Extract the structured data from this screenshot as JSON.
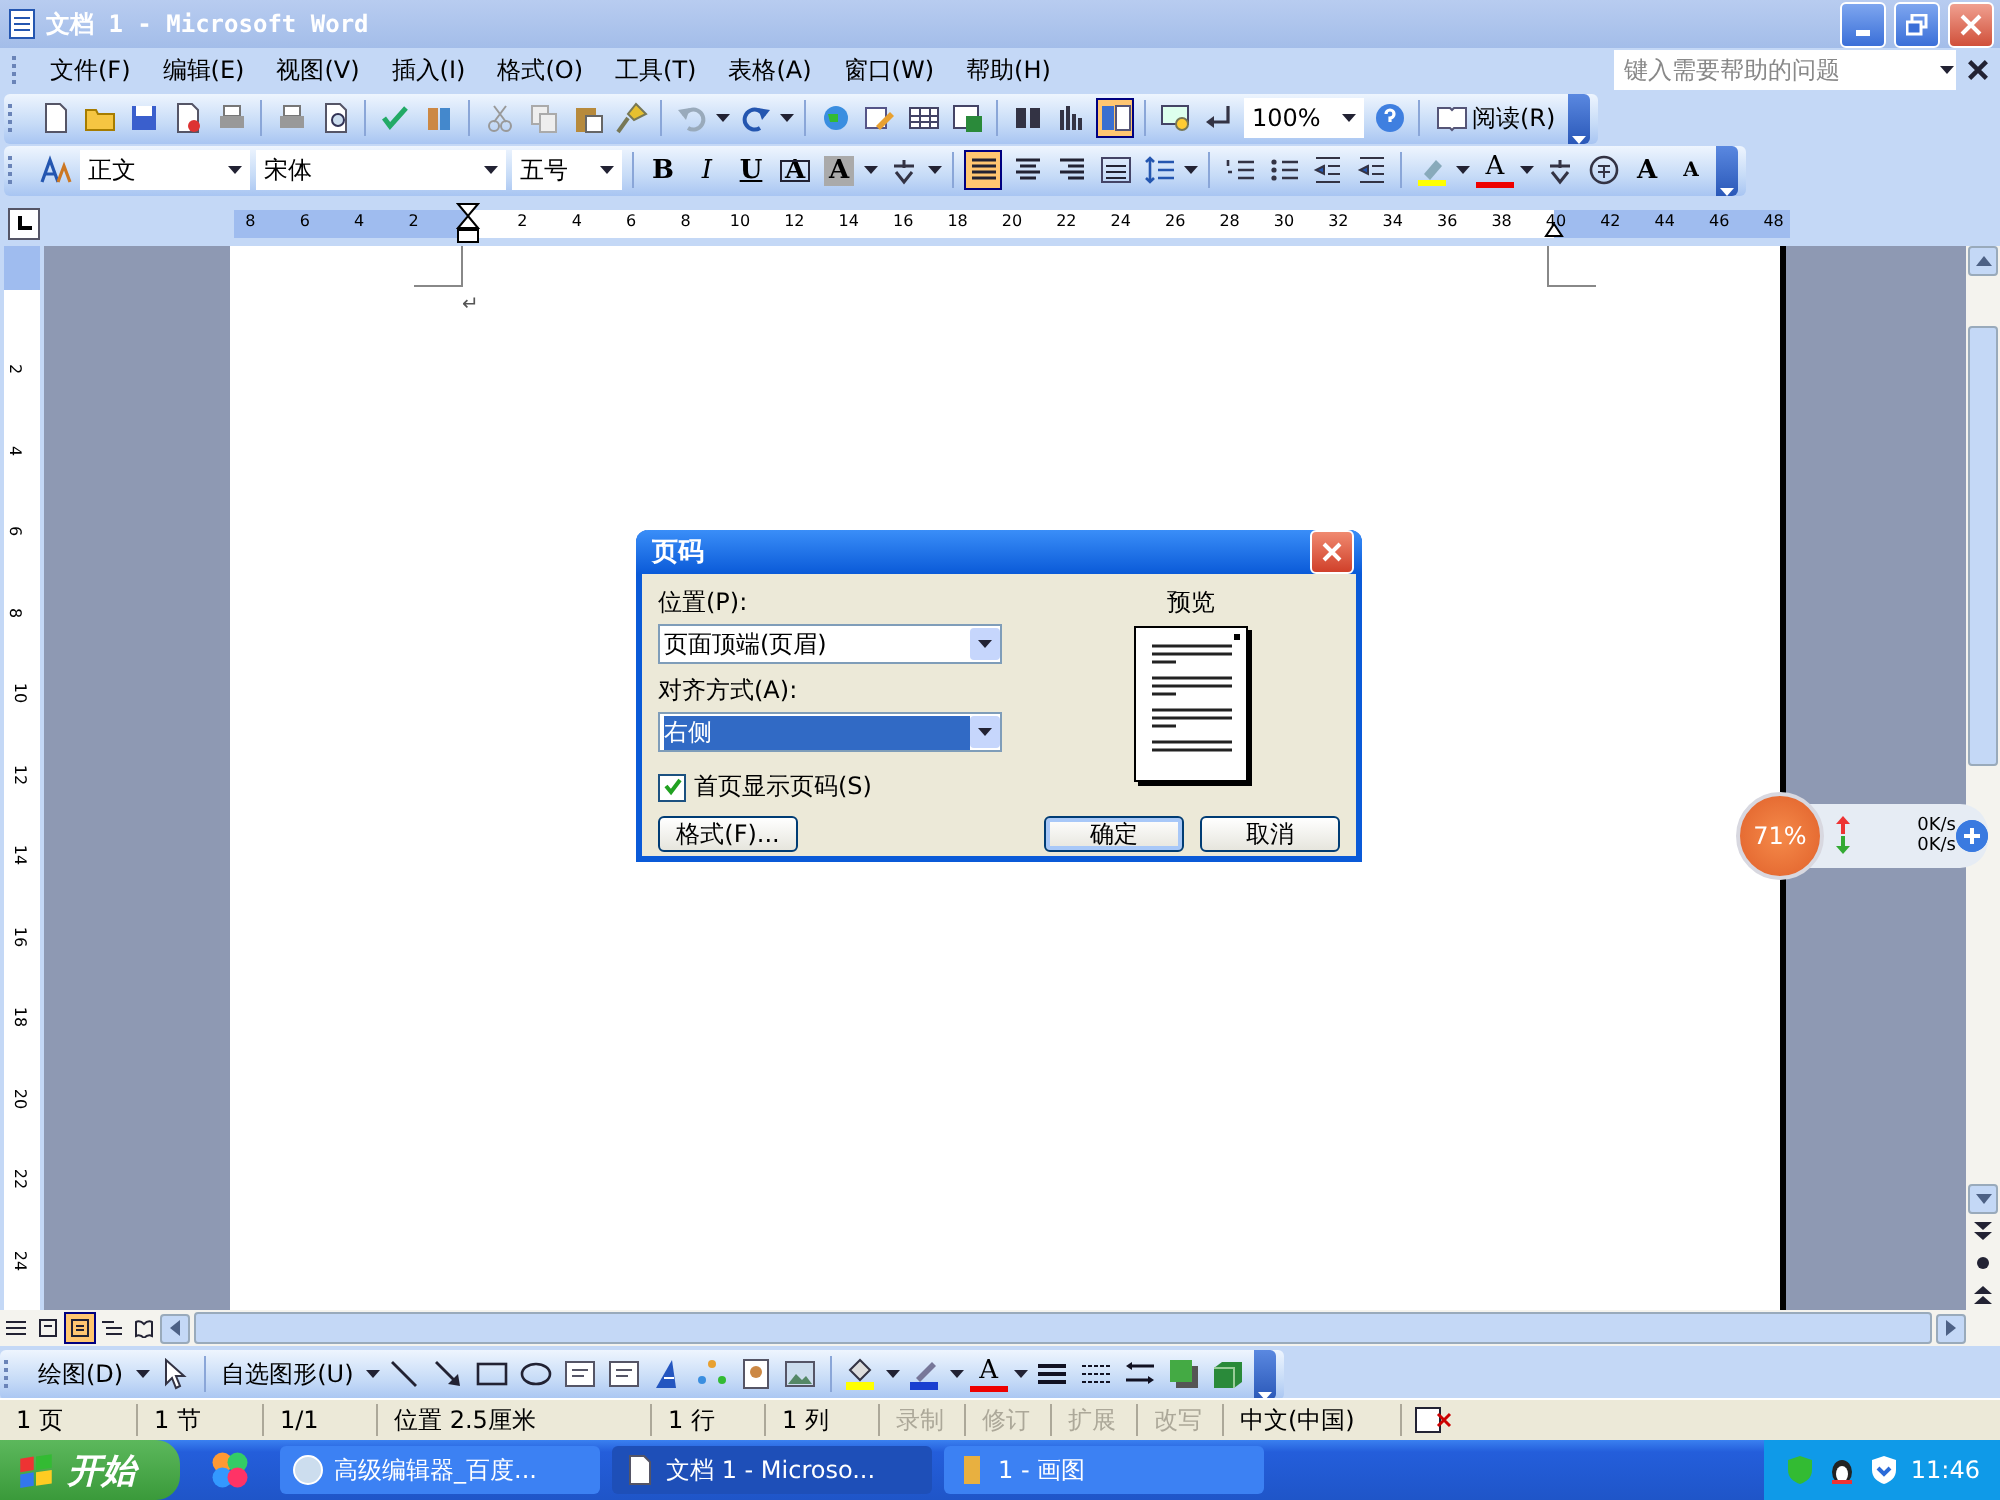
{
  "window": {
    "title": "文档 1 - Microsoft Word"
  },
  "menu_bar": {
    "items": [
      "文件(F)",
      "编辑(E)",
      "视图(V)",
      "插入(I)",
      "格式(O)",
      "工具(T)",
      "表格(A)",
      "窗口(W)",
      "帮助(H)"
    ],
    "help_search": {
      "placeholder": "键入需要帮助的问题"
    }
  },
  "standard_toolbar": {
    "document_map_on": true,
    "zoom": "100%",
    "read_button": "阅读(R)"
  },
  "formatting_toolbar": {
    "style": "正文",
    "font": "宋体",
    "size": "五号",
    "format_buttons": [
      {
        "kind": "bold",
        "label": "B"
      },
      {
        "kind": "italic",
        "label": "I"
      },
      {
        "kind": "underline",
        "label": "U"
      },
      {
        "kind": "border",
        "label": "A"
      },
      {
        "kind": "shade",
        "label": "A"
      }
    ],
    "alignment_buttons": [
      {
        "selected": true
      },
      {
        "selected": false
      },
      {
        "selected": false
      },
      {
        "selected": false
      }
    ],
    "font_color_label": "A",
    "grow_font_label": "A",
    "shrink_font_label": "A"
  },
  "ruler": {
    "left_labels": [
      "8",
      "6",
      "4",
      "2"
    ],
    "right_labels": [
      "2",
      "4",
      "6",
      "8",
      "10",
      "12",
      "14",
      "16",
      "18",
      "20",
      "22",
      "24",
      "26",
      "28",
      "30",
      "32",
      "34",
      "36",
      "38",
      "40",
      "42",
      "44",
      "46",
      "48"
    ]
  },
  "vertical_ruler": {
    "labels": [
      "2",
      "4",
      "6",
      "8",
      "10",
      "12",
      "14",
      "16",
      "18",
      "20",
      "22",
      "24"
    ]
  },
  "document": {
    "paragraph_mark": "↵"
  },
  "dialog": {
    "title": "页码",
    "position_label": "位置(P):",
    "position_value": "页面顶端(页眉)",
    "alignment_label": "对齐方式(A):",
    "alignment_value": "右侧",
    "first_page_checkbox": {
      "label": "首页显示页码(S)",
      "checked": true
    },
    "preview_label": "预览",
    "buttons": [
      {
        "kind": "format",
        "label": "格式(F)..."
      },
      {
        "kind": "ok",
        "label": "确定"
      },
      {
        "kind": "cancel",
        "label": "取消"
      }
    ]
  },
  "speed_widget": {
    "percent": "71%",
    "upload": "0K/s",
    "download": "0K/s"
  },
  "view_buttons": [
    {
      "selected": false
    },
    {
      "selected": false
    },
    {
      "selected": true
    },
    {
      "selected": false
    },
    {
      "selected": false
    }
  ],
  "drawing_toolbar": {
    "draw_menu": "绘图(D)",
    "autoshapes_menu": "自选图形(U)",
    "font_color_label": "A"
  },
  "status_bar": {
    "items": [
      {
        "text": "1 页",
        "disabled": false
      },
      {
        "text": "1 节",
        "disabled": false
      },
      {
        "text": "1/1",
        "disabled": false
      },
      {
        "text": "位置 2.5厘米",
        "disabled": false
      },
      {
        "text": "1 行",
        "disabled": false
      },
      {
        "text": "1 列",
        "disabled": false
      },
      {
        "text": "录制",
        "disabled": true
      },
      {
        "text": "修订",
        "disabled": true
      },
      {
        "text": "扩展",
        "disabled": true
      },
      {
        "text": "改写",
        "disabled": true
      },
      {
        "text": "中文(中国)",
        "disabled": false
      }
    ]
  },
  "taskbar": {
    "start": "开始",
    "tasks": [
      {
        "label": "高级编辑器_百度...",
        "selected": false
      },
      {
        "label": "文档 1 - Microso...",
        "selected": true
      },
      {
        "label": "1 - 画图",
        "selected": false
      }
    ],
    "clock": "11:46"
  }
}
